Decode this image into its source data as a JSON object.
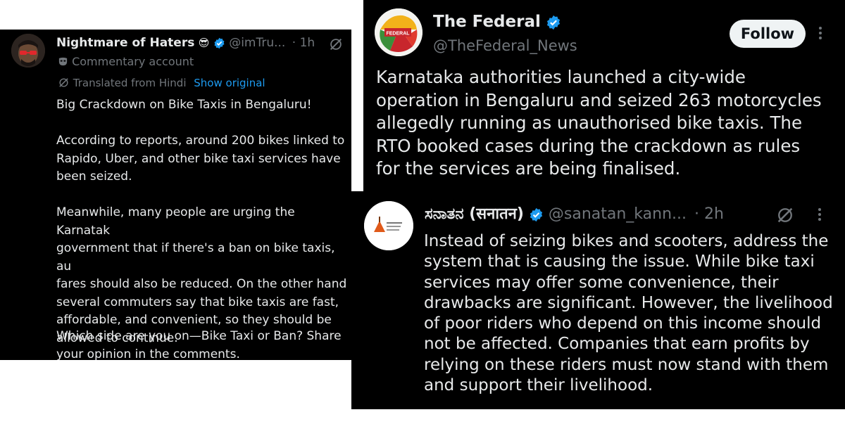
{
  "tweet_left": {
    "display_name": "Nightmare of Haters",
    "emoji": "😎",
    "handle": "@imTru...",
    "dot": "·",
    "time": "1h",
    "label": "Commentary account",
    "translated": "Translated from Hindi",
    "show_original": "Show original",
    "p1": "Big Crackdown on Bike Taxis in Bengaluru!",
    "p2": "According to reports, around 200 bikes linked to\nRapido, Uber, and other bike taxi services have\nbeen seized.",
    "p3": "Meanwhile, many people are urging the Karnatak\ngovernment that if there's a ban on bike taxis, au\nfares should also be reduced. On the other hand\nseveral commuters say that bike taxis are fast,\naffordable, and convenient, so they should be\nallowed to continue.",
    "p4": "Which side are you on—Bike Taxi or Ban? Share\nyour opinion in the comments."
  },
  "tweet_federal": {
    "display_name": "The Federal",
    "handle": "@TheFederal_News",
    "avatar_text": "FEDERAL",
    "follow_label": "Follow",
    "body": "Karnataka authorities launched a city-wide\noperation in Bengaluru and seized 263 motorcycles\nallegedly running as unauthorised bike taxis. The\nRTO booked cases during the crackdown as rules\nfor the services are being finalised."
  },
  "tweet_sanatan": {
    "display_name": "ಸನಾತನ (सनातन)",
    "handle": "@sanatan_kann...",
    "dot": "·",
    "time": "2h",
    "body": "Instead of seizing bikes and scooters, address the\nsystem that is causing the issue. While bike taxi\nservices may offer some convenience, their\ndrawbacks are significant. However, the livelihood\nof poor riders who depend on this income should\nnot be affected. Companies that earn profits by\nrelying on these riders must now stand with them\nand support their livelihood."
  },
  "colors": {
    "background": "#000000",
    "text": "#e7e9ea",
    "muted": "#71767b",
    "link": "#1d9bf0",
    "verified": "#1d9bf0"
  }
}
